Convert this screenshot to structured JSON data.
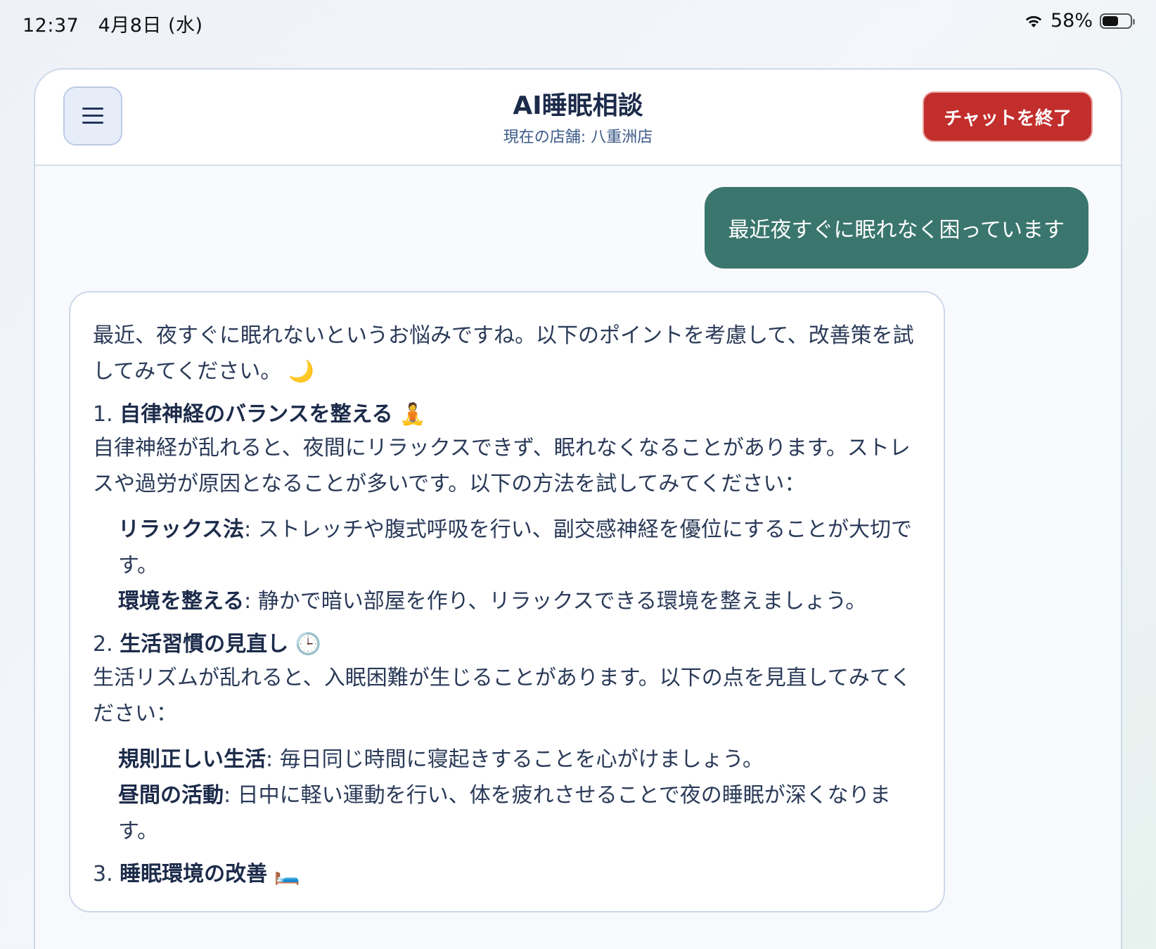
{
  "status_bar": {
    "time": "12:37",
    "date": "4月8日 (水)",
    "battery_text": "58%",
    "battery_level": 0.58,
    "wifi_icon": "wifi-icon"
  },
  "header": {
    "title": "AI睡眠相談",
    "subtitle": "現在の店舗: 八重洲店",
    "end_button": "チャットを終了",
    "menu_icon": "hamburger-menu-icon"
  },
  "colors": {
    "user_bubble": "#3a766d",
    "end_button": "#c22e2c",
    "menu_button_bg": "#e6edf9"
  },
  "messages": {
    "user": "最近夜すぐに眠れなく困っています",
    "ai": {
      "intro": "最近、夜すぐに眠れないというお悩みですね。以下のポイントを考慮して、改善策を試してみてください。",
      "intro_emoji": "🌙",
      "sections": [
        {
          "number": "1.",
          "title": "自律神経のバランスを整える",
          "emoji": "🧘",
          "body": "自律神経が乱れると、夜間にリラックスできず、眠れなくなることがあります。ストレスや過労が原因となることが多いです。以下の方法を試してみてください：",
          "bullets": [
            {
              "term": "リラックス法",
              "text": ": ストレッチや腹式呼吸を行い、副交感神経を優位にすることが大切です。"
            },
            {
              "term": "環境を整える",
              "text": ": 静かで暗い部屋を作り、リラックスできる環境を整えましょう。"
            }
          ]
        },
        {
          "number": "2.",
          "title": "生活習慣の見直し",
          "emoji": "🕒",
          "body": "生活リズムが乱れると、入眠困難が生じることがあります。以下の点を見直してみてください：",
          "bullets": [
            {
              "term": "規則正しい生活",
              "text": ": 毎日同じ時間に寝起きすることを心がけましょう。"
            },
            {
              "term": "昼間の活動",
              "text": ": 日中に軽い運動を行い、体を疲れさせることで夜の睡眠が深くなります。"
            }
          ]
        },
        {
          "number": "3.",
          "title": "睡眠環境の改善",
          "emoji": "🛏️"
        }
      ]
    }
  }
}
